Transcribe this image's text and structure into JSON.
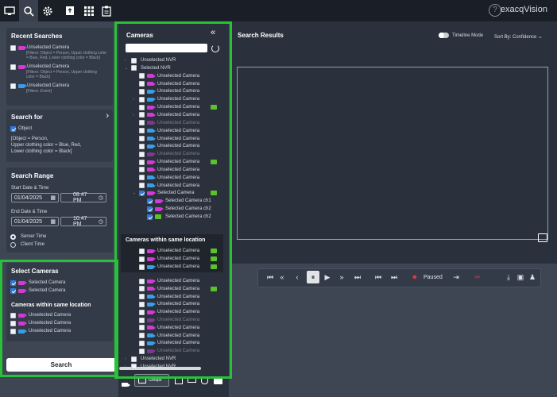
{
  "brand": "exacqVision",
  "help_label": "?",
  "topbar": {
    "icons": [
      "monitor-icon",
      "search-icon",
      "settings-icon",
      "export-icon",
      "grid-icon",
      "clipboard-icon"
    ]
  },
  "recent": {
    "title": "Recent Searches",
    "items": [
      {
        "name": "Unselected Camera",
        "detail1": "[Filters: Object = Person, Upper clothing color",
        "detail2": "= Blue, Red, Lower clothing color = Black]",
        "icon": "m"
      },
      {
        "name": "Unselected Camera",
        "detail1": "[Filters: Object = Person, Upper clothing",
        "detail2": "color = Black]",
        "icon": "m"
      },
      {
        "name": "Unselected Camera",
        "detail1": "[Filters: Event]",
        "detail2": "",
        "icon": "b"
      }
    ]
  },
  "search_for": {
    "title": "Search for",
    "option": "Object",
    "summary1": "[Object = Person,",
    "summary2": "Upper clothing color = Blue, Red,",
    "summary3": "Lower clothing color = Black]"
  },
  "range": {
    "title": "Search Range",
    "start_label": "Start Date & Time",
    "start_date": "01/04/2025",
    "start_time": "08:47 PM",
    "end_label": "End Date & Time",
    "end_date": "01/04/2025",
    "end_time": "10:47 PM",
    "server_time": "Server Time",
    "client_time": "Client Time"
  },
  "selected": {
    "title": "Select Cameras",
    "cams": [
      "Selected Camera",
      "Selected Camera"
    ],
    "loc_title": "Cameras within same location",
    "loc_cams": [
      "Unselected Camera",
      "Unselected Camera",
      "Unselected Camera"
    ]
  },
  "search_button": "Search",
  "cameras": {
    "title": "Cameras",
    "collapse": "«",
    "tree": [
      {
        "label": "Unselected NVR",
        "level": 0,
        "arrow": "›",
        "cb": "off"
      },
      {
        "label": "Selected NVR",
        "level": 0,
        "arrow": "⌄",
        "cb": "off"
      },
      {
        "label": "Unselected Camera",
        "level": 1,
        "icon": "m"
      },
      {
        "label": "Unselected Camera",
        "level": 1,
        "icon": "m"
      },
      {
        "label": "Unselected Camera",
        "level": 1,
        "icon": "b"
      },
      {
        "label": "Unselected Camera",
        "level": 1,
        "icon": "b",
        "arrow": "›"
      },
      {
        "label": "Unselected Camera",
        "level": 1,
        "icon": "m",
        "ai": true
      },
      {
        "label": "Unselected Camera",
        "level": 1,
        "icon": "m",
        "arrow": "›"
      },
      {
        "label": "Unselected Camera",
        "level": 1,
        "icon": "g",
        "dim": true
      },
      {
        "label": "Unselected Camera",
        "level": 1,
        "icon": "b"
      },
      {
        "label": "Unselected Camera",
        "level": 1,
        "icon": "b"
      },
      {
        "label": "Unselected Camera",
        "level": 1,
        "icon": "b"
      },
      {
        "label": "Unselected Camera",
        "level": 1,
        "icon": "g",
        "dim": true
      },
      {
        "label": "Unselected Camera",
        "level": 1,
        "icon": "m",
        "ai": true
      },
      {
        "label": "Unselected Camera",
        "level": 1,
        "icon": "m"
      },
      {
        "label": "Unselected Camera",
        "level": 1,
        "icon": "b"
      },
      {
        "label": "Unselected Camera",
        "level": 1,
        "icon": "b"
      },
      {
        "label": "Selected Camera",
        "level": 1,
        "icon": "m",
        "ai": true,
        "cb": "on",
        "arrow": "⌄"
      },
      {
        "label": "Selected Camera ch1",
        "level": 2,
        "icon": "m",
        "cb": "on"
      },
      {
        "label": "Selected Camera ch2",
        "level": 2,
        "icon": "m",
        "cb": "on"
      },
      {
        "label": "Selected Camera ch2",
        "level": 2,
        "icon": "ai",
        "cb": "on"
      }
    ],
    "loc_title": "Cameras within same location",
    "loc": [
      {
        "label": "Unselected Camera",
        "icon": "m",
        "ai": true
      },
      {
        "label": "Unselected Camera",
        "icon": "m",
        "ai": true
      },
      {
        "label": "Unselected Camera",
        "icon": "b",
        "ai": true
      }
    ],
    "tree2": [
      {
        "label": "Unselected Camera",
        "level": 1,
        "icon": "m"
      },
      {
        "label": "Unselected Camera",
        "level": 1,
        "icon": "m",
        "ai": true
      },
      {
        "label": "Unselected Camera",
        "level": 1,
        "icon": "b"
      },
      {
        "label": "Unselected Camera",
        "level": 1,
        "icon": "b"
      },
      {
        "label": "Unselected Camera",
        "level": 1,
        "icon": "m"
      },
      {
        "label": "Unselected Camera",
        "level": 1,
        "icon": "g",
        "dim": true
      },
      {
        "label": "Unselected Camera",
        "level": 1,
        "icon": "m"
      },
      {
        "label": "Unselected Camera",
        "level": 1,
        "icon": "b"
      },
      {
        "label": "Unselected Camera",
        "level": 1,
        "icon": "b"
      },
      {
        "label": "Unselected Camera",
        "level": 1,
        "icon": "g",
        "dim": true
      },
      {
        "label": "Unselected NVR",
        "level": 0,
        "arrow": "›"
      },
      {
        "label": "Unselected NVR",
        "level": 0,
        "arrow": "›"
      }
    ],
    "groups_label": "Groups"
  },
  "results": {
    "title": "Search Results",
    "timeline_label": "Timeline Mode",
    "sort_label": "Sort By: Confidence"
  },
  "player": {
    "status": "Paused"
  }
}
